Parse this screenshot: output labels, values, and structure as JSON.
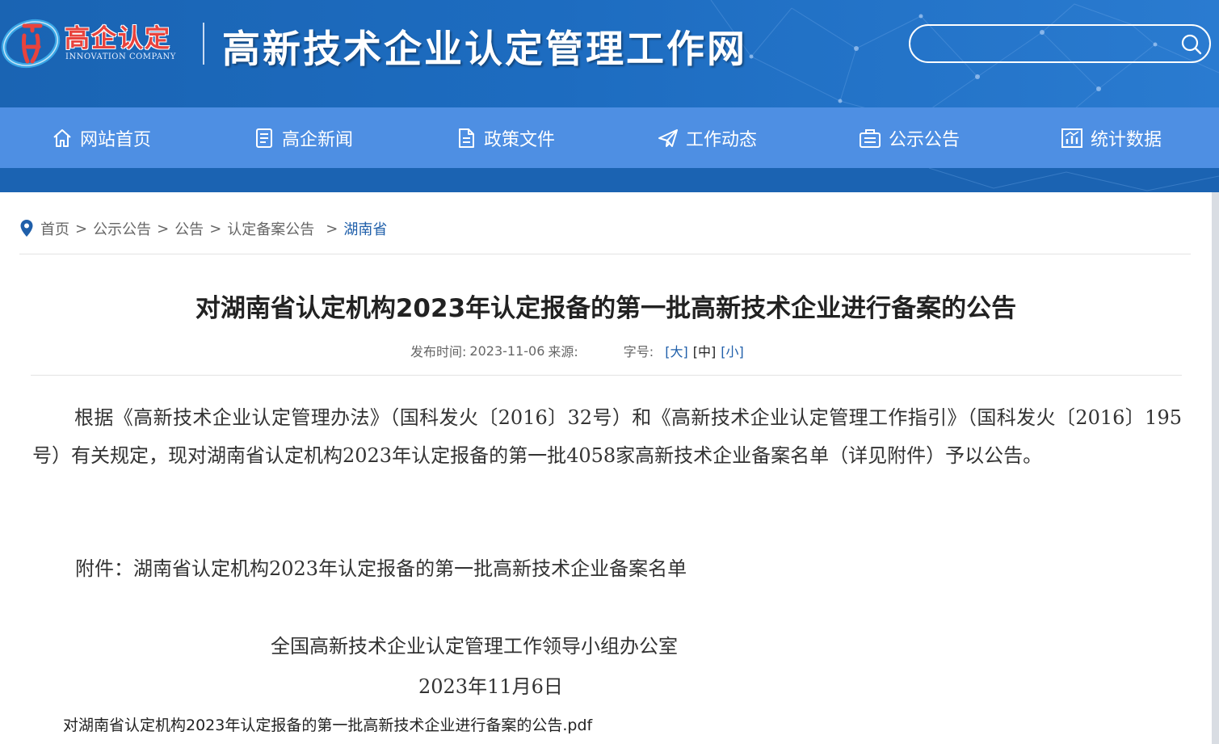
{
  "header": {
    "logo_cn": "高企认定",
    "logo_en": "INNOVATION COMPANY",
    "site_title": "高新技术企业认定管理工作网",
    "search": {
      "value": "",
      "placeholder": ""
    }
  },
  "nav": {
    "items": [
      {
        "label": "网站首页",
        "icon": "home-icon"
      },
      {
        "label": "高企新闻",
        "icon": "news-icon"
      },
      {
        "label": "政策文件",
        "icon": "document-icon"
      },
      {
        "label": "工作动态",
        "icon": "paper-plane-icon"
      },
      {
        "label": "公示公告",
        "icon": "notice-icon"
      },
      {
        "label": "统计数据",
        "icon": "chart-icon"
      }
    ]
  },
  "breadcrumb": {
    "items": [
      "首页",
      "公示公告",
      "公告",
      "认定备案公告",
      "湖南省"
    ],
    "separator": ">"
  },
  "article": {
    "title": "对湖南省认定机构2023年认定报备的第一批高新技术企业进行备案的公告",
    "meta": {
      "publish_label": "发布时间:",
      "publish_date": "2023-11-06",
      "source_label": "来源:",
      "source": "",
      "font_size_label": "字号:",
      "font_sizes": [
        "[大]",
        "[中]",
        "[小]"
      ]
    },
    "body": "根据《高新技术企业认定管理办法》（国科发火〔2016〕32号）和《高新技术企业认定管理工作指引》（国科发火〔2016〕195号）有关规定，现对湖南省认定机构2023年认定报备的第一批4058家高新技术企业备案名单（详见附件）予以公告。",
    "attachment_line": "附件：湖南省认定机构2023年认定报备的第一批高新技术企业备案名单",
    "signature_org": "全国高新技术企业认定管理工作领导小组办公室",
    "signature_date": "2023年11月6日",
    "attachment_file": "对湖南省认定机构2023年认定报备的第一批高新技术企业进行备案的公告.pdf"
  },
  "colors": {
    "header_blue": "#1d6cc0",
    "nav_blue": "#4e8fe3",
    "logo_red": "#e8433d",
    "link_blue": "#1f5faa"
  }
}
